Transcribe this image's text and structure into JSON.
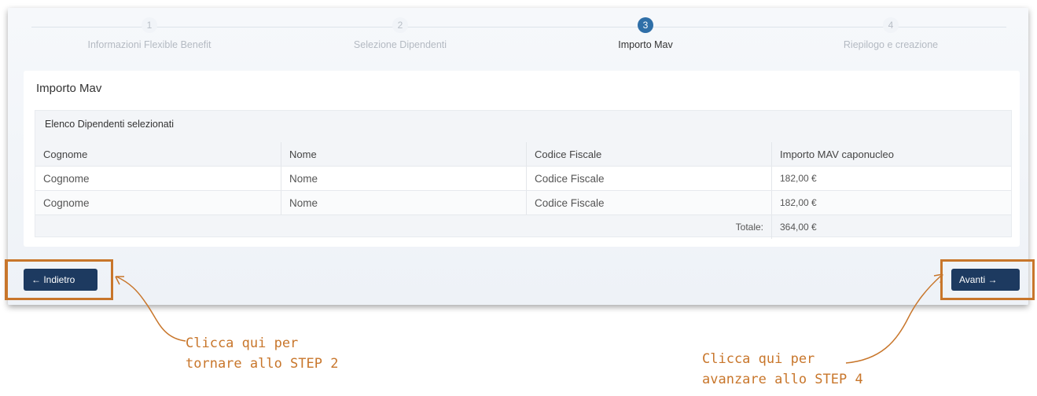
{
  "stepper": {
    "steps": [
      {
        "number": "1",
        "label": "Informazioni Flexible Benefit",
        "active": false
      },
      {
        "number": "2",
        "label": "Selezione Dipendenti",
        "active": false
      },
      {
        "number": "3",
        "label": "Importo Mav",
        "active": true
      },
      {
        "number": "4",
        "label": "Riepilogo e creazione",
        "active": false
      }
    ]
  },
  "card": {
    "title": "Importo Mav",
    "panel_title": "Elenco Dipendenti selezionati",
    "table": {
      "headers": [
        "Cognome",
        "Nome",
        "Codice Fiscale",
        "Importo MAV caponucleo"
      ],
      "rows": [
        [
          "Cognome",
          "Nome",
          "Codice Fiscale",
          "182,00 €"
        ],
        [
          "Cognome",
          "Nome",
          "Codice Fiscale",
          "182,00 €"
        ]
      ],
      "total_label": "Totale:",
      "total_value": "364,00 €"
    }
  },
  "footer": {
    "back_label": "← Indietro",
    "next_label": "Avanti →"
  },
  "annotations": {
    "left_line1": "Clicca qui per",
    "left_line2": "tornare allo STEP 2",
    "right_line1": "Clicca qui per",
    "right_line2": "avanzare allo STEP 4"
  },
  "colors": {
    "accent": "#2f6fa8",
    "button": "#1d3a60",
    "amount": "#3b8a2f",
    "annotation": "#c8762b"
  }
}
